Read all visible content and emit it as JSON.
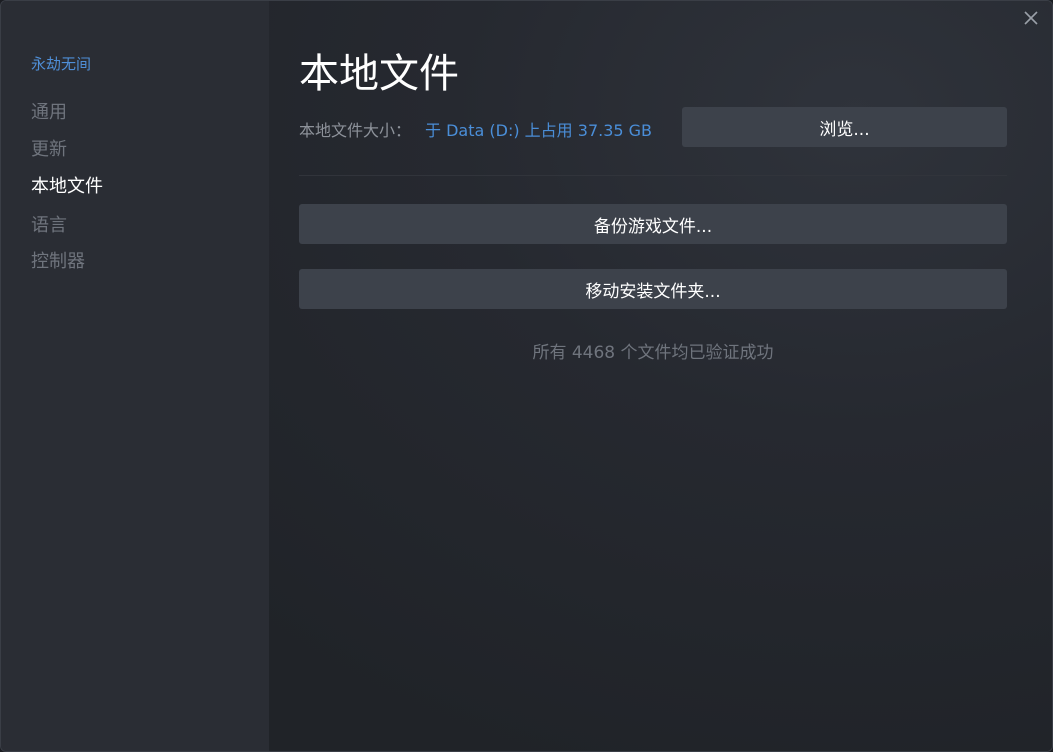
{
  "sidebar": {
    "game_title": "永劫无间",
    "items": [
      {
        "label": "通用",
        "active": false
      },
      {
        "label": "更新",
        "active": false
      },
      {
        "label": "本地文件",
        "active": true
      },
      {
        "label": "语言",
        "active": false
      },
      {
        "label": "控制器",
        "active": false
      }
    ]
  },
  "main": {
    "title": "本地文件",
    "size_label": "本地文件大小：",
    "size_value": "于 Data (D:) 上占用 37.35 GB",
    "browse_label": "浏览...",
    "backup_label": "备份游戏文件...",
    "move_label": "移动安装文件夹...",
    "verify_status": "所有 4468 个文件均已验证成功"
  },
  "icons": {
    "close": "close-icon"
  },
  "colors": {
    "accent": "#4a8ed8",
    "button_bg": "#3d424b",
    "sidebar_bg": "#2a2d34",
    "muted_text": "#6f747d"
  }
}
